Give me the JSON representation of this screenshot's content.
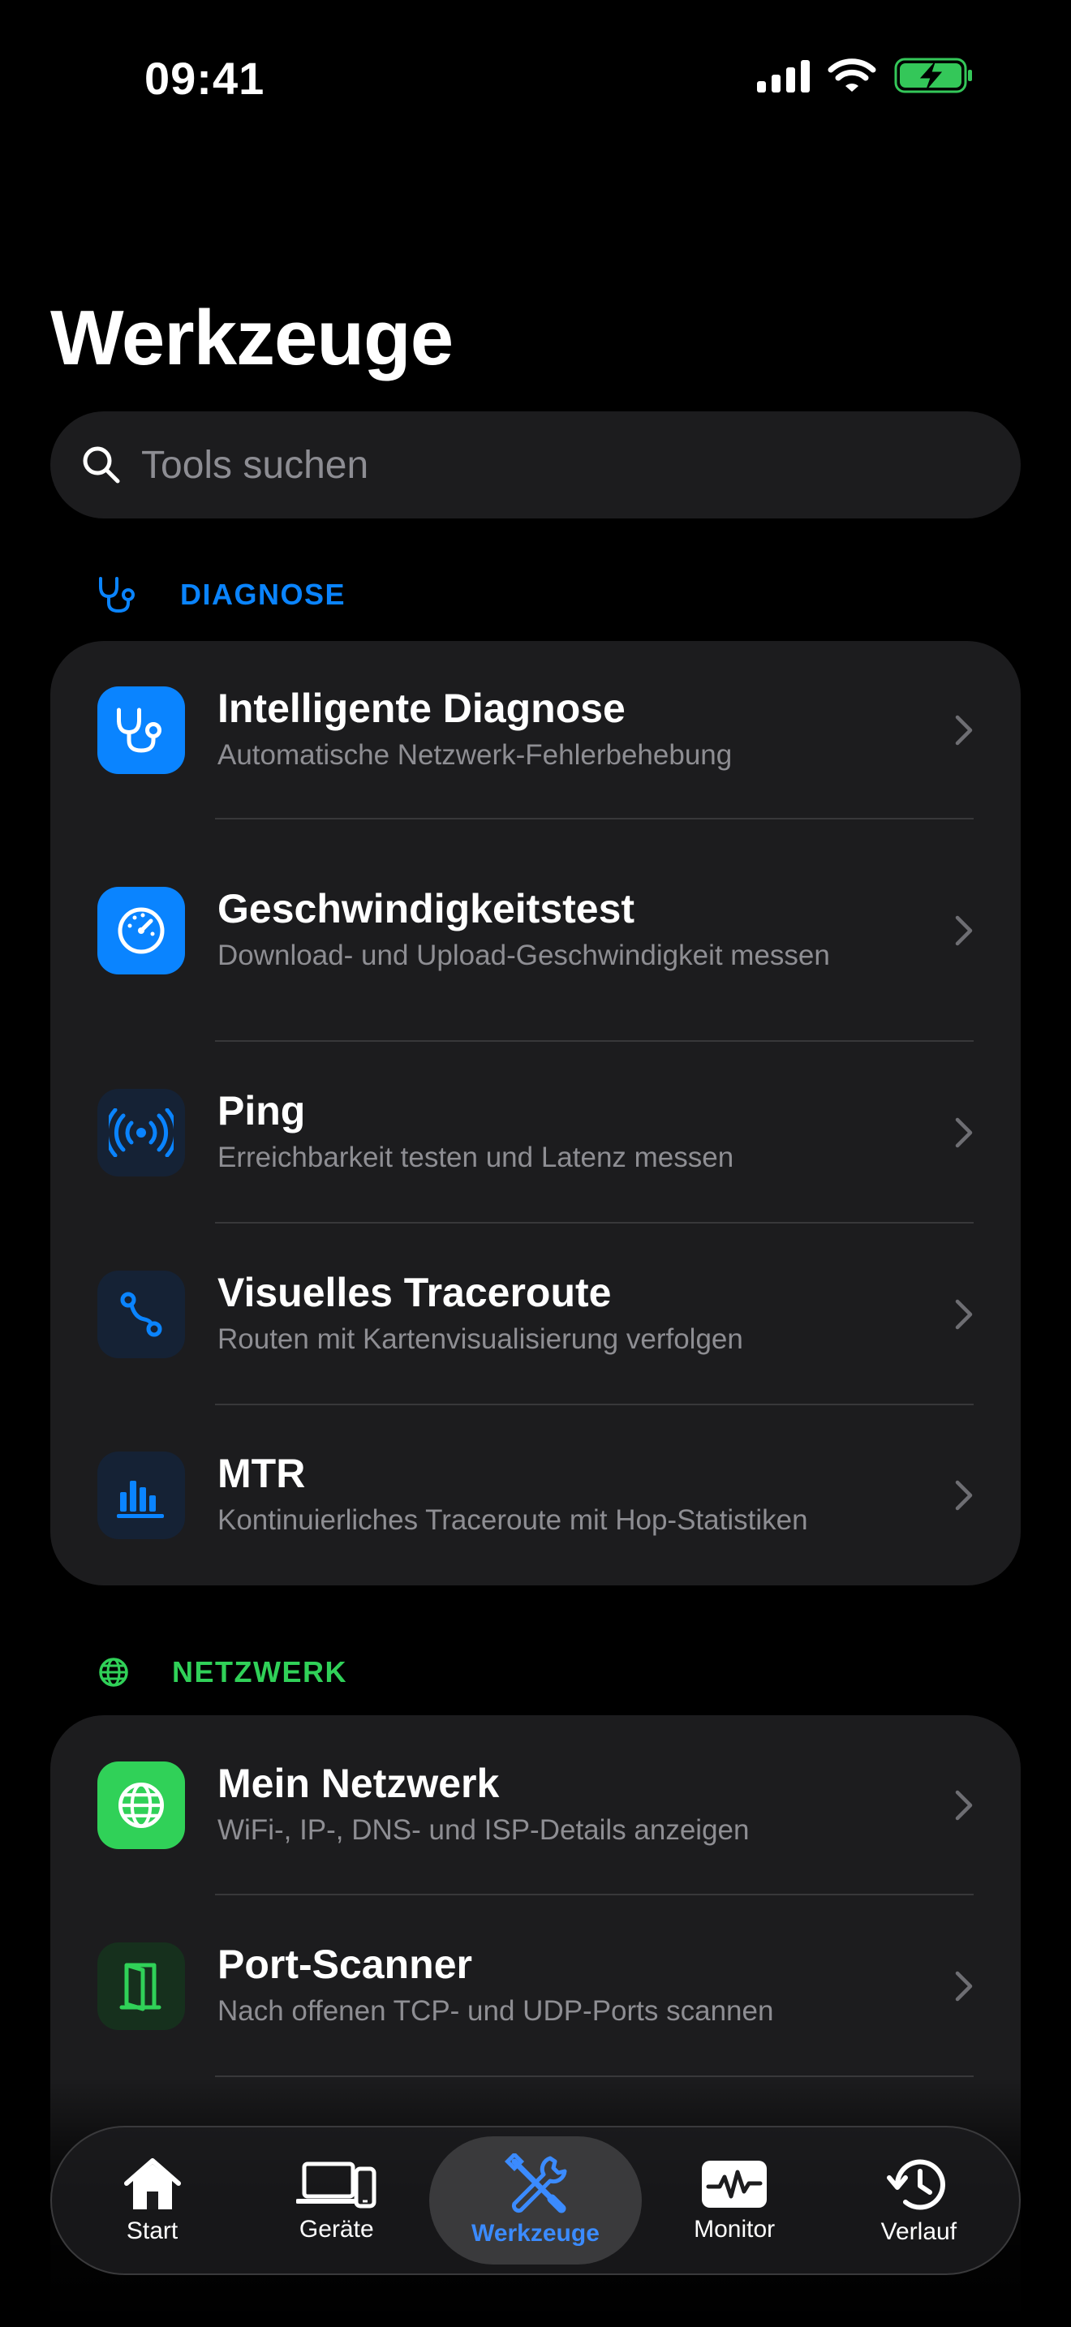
{
  "status_bar": {
    "time": "09:41"
  },
  "page": {
    "title": "Werkzeuge"
  },
  "search": {
    "placeholder": "Tools suchen"
  },
  "colors": {
    "accent_blue": "#0a84ff",
    "accent_green": "#30d158",
    "card_bg": "#1c1c1e",
    "battery_green": "#34c759"
  },
  "sections": {
    "diagnose": {
      "label": "DIAGNOSE",
      "icon": "stethoscope-icon",
      "items": [
        {
          "title": "Intelligente Diagnose",
          "subtitle": "Automatische Netzwerk-Fehlerbehebung",
          "icon": "stethoscope-icon"
        },
        {
          "title": "Geschwindigkeitstest",
          "subtitle": "Download- und Upload-Geschwindigkeit messen",
          "icon": "speedometer-icon"
        },
        {
          "title": "Ping",
          "subtitle": "Erreichbarkeit testen und Latenz messen",
          "icon": "broadcast-icon"
        },
        {
          "title": "Visuelles Traceroute",
          "subtitle": "Routen mit Kartenvisualisierung verfolgen",
          "icon": "route-icon"
        },
        {
          "title": "MTR",
          "subtitle": "Kontinuierliches Traceroute mit Hop-Statistiken",
          "icon": "bar-chart-icon"
        }
      ]
    },
    "netzwerk": {
      "label": "NETZWERK",
      "icon": "globe-icon",
      "items": [
        {
          "title": "Mein Netzwerk",
          "subtitle": "WiFi-, IP-, DNS- und ISP-Details anzeigen",
          "icon": "globe-icon"
        },
        {
          "title": "Port-Scanner",
          "subtitle": "Nach offenen TCP- und UDP-Ports scannen",
          "icon": "door-icon"
        }
      ]
    }
  },
  "tab_bar": {
    "tabs": [
      {
        "label": "Start",
        "icon": "house-icon",
        "active": false
      },
      {
        "label": "Geräte",
        "icon": "devices-icon",
        "active": false
      },
      {
        "label": "Werkzeuge",
        "icon": "wrench-screwdriver-icon",
        "active": true
      },
      {
        "label": "Monitor",
        "icon": "waveform-monitor-icon",
        "active": false
      },
      {
        "label": "Verlauf",
        "icon": "history-icon",
        "active": false
      }
    ]
  }
}
